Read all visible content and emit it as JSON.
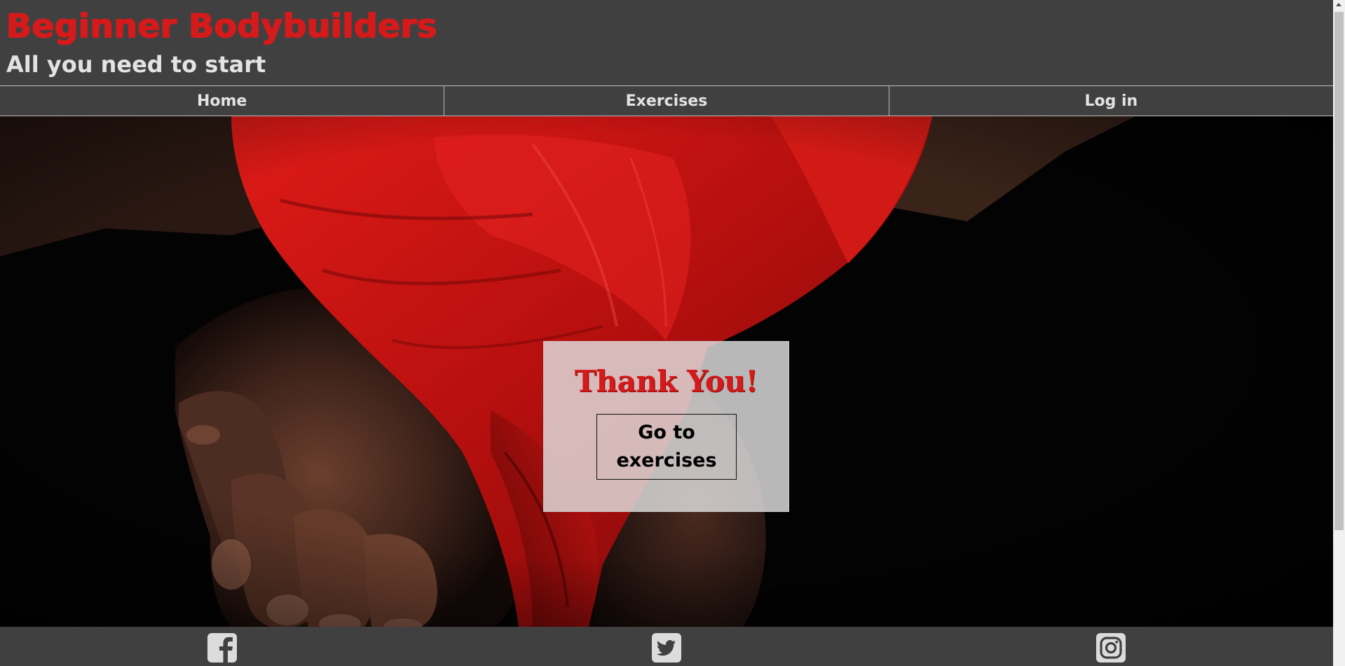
{
  "header": {
    "title": "Beginner Bodybuilders",
    "tagline": "All you need to start"
  },
  "nav": {
    "items": [
      {
        "label": "Home"
      },
      {
        "label": "Exercises"
      },
      {
        "label": "Log in"
      }
    ]
  },
  "card": {
    "heading": "Thank You!",
    "button_label": "Go to exercises"
  },
  "footer": {
    "social": [
      {
        "icon": "facebook-icon"
      },
      {
        "icon": "twitter-icon"
      },
      {
        "icon": "instagram-icon"
      }
    ]
  },
  "colors": {
    "background": "#404040",
    "accent_red": "#d41a1a",
    "text_light": "#e3e3e3"
  }
}
